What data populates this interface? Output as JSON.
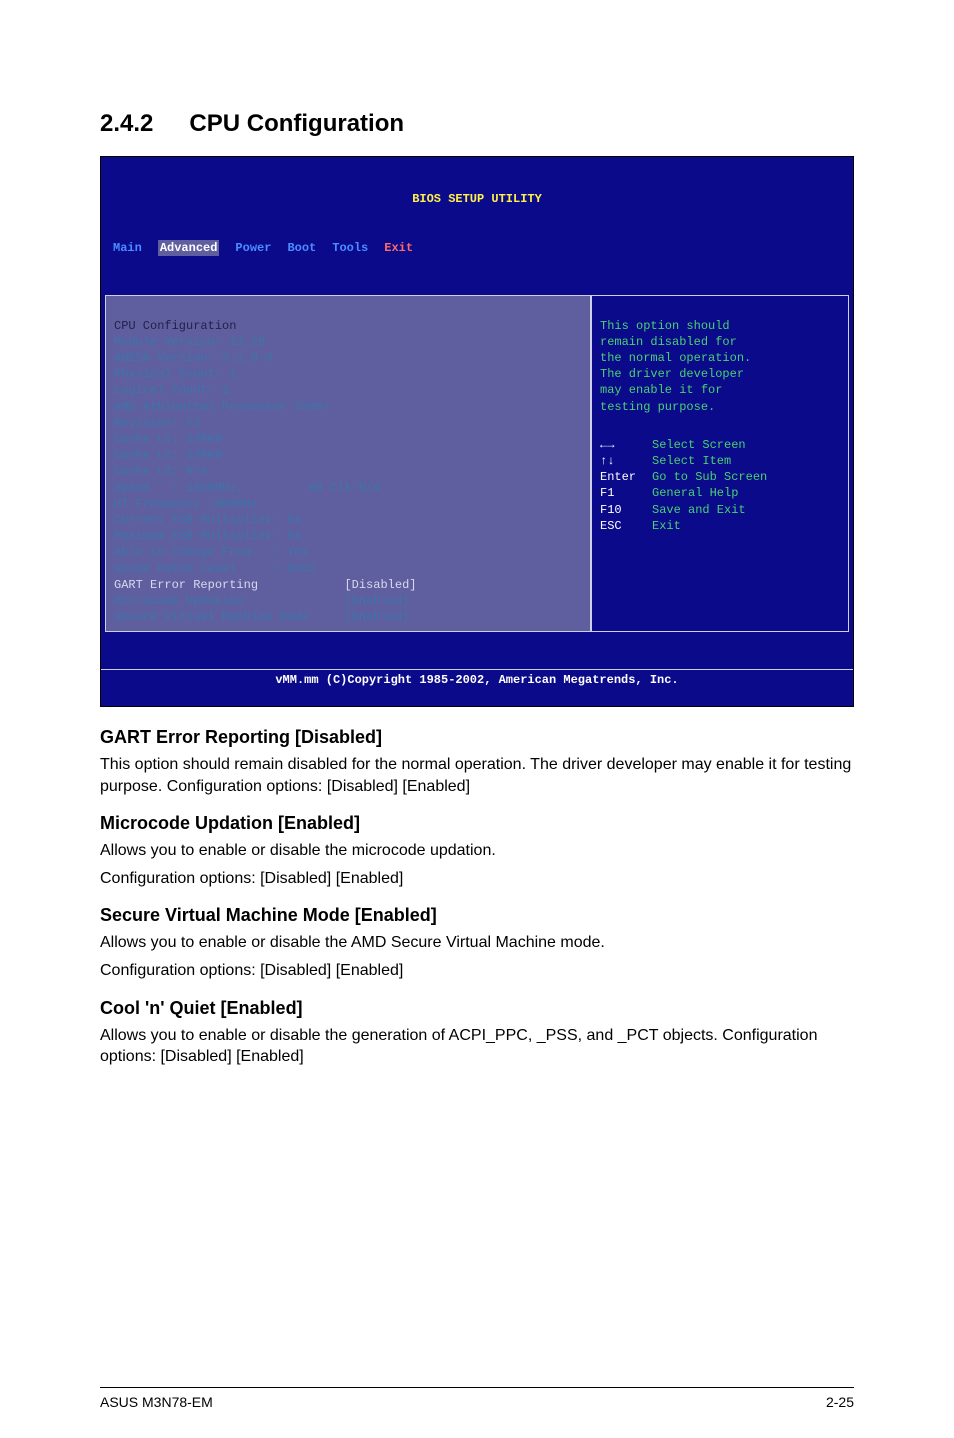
{
  "section": {
    "number": "2.4.2",
    "title": "CPU Configuration"
  },
  "bios": {
    "title": "BIOS SETUP UTILITY",
    "tabs": {
      "main": "Main",
      "advanced": "Advanced",
      "power": "Power",
      "boot": "Boot",
      "tools": "Tools",
      "exit": "Exit"
    },
    "left": {
      "hdr": "CPU Configuration",
      "l1": "Module Version: 13.29",
      "l2": "AGESA Version: 3.1.8.0",
      "l3": "Physical Count: 1",
      "l4": "Logical Count: 1",
      "l5": "AMD Athlon(tm) Processor 3200+",
      "l6": "Revision: F2",
      "l7": "Cache L1: 128KB",
      "l8": "Cache L2: 128KB",
      "l9": "Cache L3: N/A",
      "l10": "Speed   : 1800MHz,         NB Clk:N/A",
      "l11": "HT Frequency :800MHz",
      "l12": "Current FSB Multiplier: 9x",
      "l13": "Maximum FSB Multiplier: 9x",
      "l14": "Able to Change Freq.  : Yes",
      "l15": "uCode Patch Level     : 0x62",
      "opt1_label": "GART Error Reporting",
      "opt1_val": "[Disabled]",
      "opt2_label": "Microcode Updation",
      "opt2_val": "[Enabled]",
      "opt3_label": "Secure Virtual Machine Mode",
      "opt3_val": "[Enabled]"
    },
    "right": {
      "help1": "This option should",
      "help2": "remain disabled for",
      "help3": "the normal operation.",
      "help4": "The driver developer",
      "help5": "may enable it for",
      "help6": "testing purpose.",
      "k1": "←→",
      "k1t": "Select Screen",
      "k2": "↑↓",
      "k2t": "Select Item",
      "k3": "Enter",
      "k3t": "Go to Sub Screen",
      "k4": "F1",
      "k4t": "General Help",
      "k5": "F10",
      "k5t": "Save and Exit",
      "k6": "ESC",
      "k6t": "Exit"
    },
    "footer": "vMM.mm (C)Copyright 1985-2002, American Megatrends, Inc."
  },
  "doc": {
    "h1": "GART Error Reporting [Disabled]",
    "p1": "This option should remain disabled for the normal operation. The driver developer may enable it for testing purpose. Configuration options: [Disabled] [Enabled]",
    "h2": "Microcode Updation [Enabled]",
    "p2a": "Allows you to enable or disable the microcode updation.",
    "p2b": "Configuration options: [Disabled] [Enabled]",
    "h3": "Secure Virtual Machine Mode [Enabled]",
    "p3a": "Allows you to enable or disable the AMD Secure Virtual Machine mode.",
    "p3b": "Configuration options: [Disabled] [Enabled]",
    "h4": "Cool 'n' Quiet [Enabled]",
    "p4": "Allows you to enable or disable the generation of ACPI_PPC, _PSS, and _PCT objects. Configuration options: [Disabled] [Enabled]"
  },
  "footer": {
    "left": "ASUS M3N78-EM",
    "right": "2-25"
  }
}
